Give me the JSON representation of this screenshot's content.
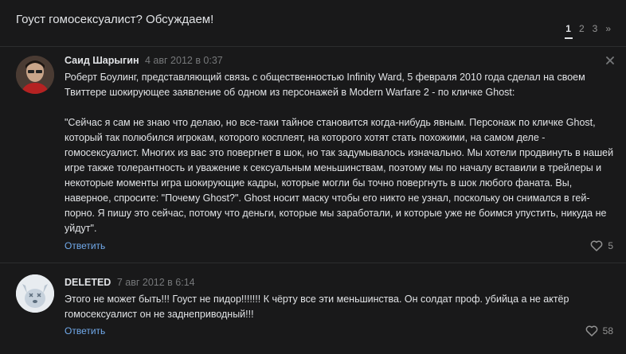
{
  "topic": {
    "title": "Гоуст гомосексуалист? Обсуждаем!"
  },
  "pagination": {
    "pages": [
      "1",
      "2",
      "3"
    ],
    "current": "1",
    "next": "»"
  },
  "posts": [
    {
      "author": "Саид Шарыгин",
      "date": "4 авг 2012 в 0:37",
      "paragraphs": [
        "Роберт Боулинг, представляющий связь с общественностью Infinity Ward, 5 февраля 2010 года сделал на своем Твиттере шокирующее заявление об одном из персонажей в Modern Warfare 2 - по кличке Ghost:",
        "\"Сейчас я сам не знаю что делаю, но все-таки тайное становится когда-нибудь явным. Персонаж по кличке Ghost, который так полюбился игрокам, которого косплеят, на которого хотят стать похожими, на самом деле - гомосексуалист. Многих из вас это повергнет в шок, но так задумывалось изначально. Мы хотели продвинуть в нашей игре также толерантность и уважение к сексуальным меньшинствам, поэтому мы по началу вставили в трейлеры и некоторые моменты игра шокирующие кадры, которые могли бы точно повергнуть в шок любого фаната. Вы, наверное, спросите: \"Почему Ghost?\". Ghost носит маску чтобы его никто не узнал, поскольку он снимался в гей-порно. Я пишу это сейчас, потому что деньги, которые мы заработали, и которые уже не боимся упустить, никуда не уйдут\"."
      ],
      "reply_label": "Ответить",
      "likes": "5"
    },
    {
      "author": "DELETED",
      "date": "7 авг 2012 в 6:14",
      "paragraphs": [
        "Этого не может быть!!! Гоуст не пидор!!!!!!! К чёрту все эти меньшинства. Он солдат проф. убийца а не актёр гомосексуалист он не заднеприводный!!!"
      ],
      "reply_label": "Ответить",
      "likes": "58"
    }
  ],
  "colors": {
    "background": "#19191a",
    "text": "#e1e3e6",
    "muted": "#76787a",
    "link": "#71aaeb",
    "divider": "#2c2d2e"
  },
  "icons": [
    "close-icon",
    "heart-icon",
    "deleted-dog-avatar-icon"
  ]
}
